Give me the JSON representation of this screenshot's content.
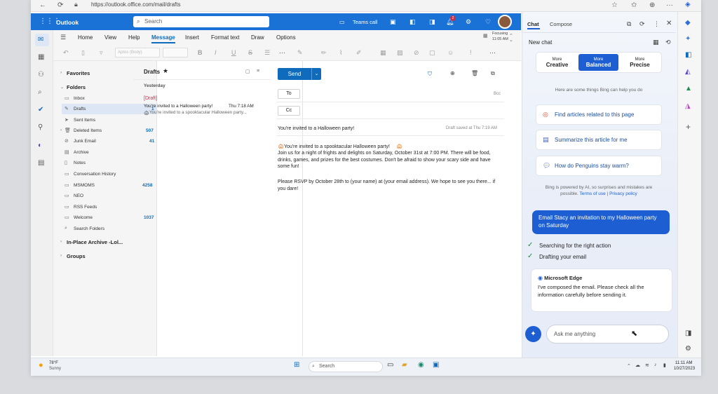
{
  "browser": {
    "url": "https://outlook.office.com/mail/drafts"
  },
  "outlook": {
    "app_name": "Outlook",
    "search_placeholder": "Search",
    "teams_call": "Teams call",
    "notif_count": "2",
    "focusing_label": "Focusing",
    "focusing_time": "11:05 AM",
    "tabs": [
      "Home",
      "View",
      "Help",
      "Message",
      "Insert",
      "Format text",
      "Draw",
      "Options"
    ],
    "active_tab": "Message",
    "font_name_placeholder": "Aptos (Body)",
    "folders": {
      "favorites_label": "Favorites",
      "folders_label": "Folders",
      "items": [
        {
          "label": "Inbox",
          "count": ""
        },
        {
          "label": "Drafts",
          "count": "1"
        },
        {
          "label": "Sent Items",
          "count": ""
        },
        {
          "label": "Deleted Items",
          "count": "507"
        },
        {
          "label": "Junk Email",
          "count": "41"
        },
        {
          "label": "Archive",
          "count": ""
        },
        {
          "label": "Notes",
          "count": ""
        },
        {
          "label": "Conversation History",
          "count": ""
        },
        {
          "label": "MSMOMS",
          "count": "4258"
        },
        {
          "label": "NEO",
          "count": ""
        },
        {
          "label": "RSS Feeds",
          "count": ""
        },
        {
          "label": "Welcome",
          "count": "1037"
        },
        {
          "label": "Search Folders",
          "count": ""
        }
      ],
      "archive_label": "In-Place Archive -Lol...",
      "groups_label": "Groups"
    },
    "message_list": {
      "title": "Drafts",
      "section": "Yesterday",
      "item": {
        "tag": "[Draft]",
        "subject": "You're invited to a Halloween party!",
        "time": "Thu 7:18 AM",
        "preview": "You're invited to a spooktacular Halloween party..."
      }
    },
    "compose": {
      "send_label": "Send",
      "to_label": "To",
      "cc_label": "Cc",
      "bcc_label": "Bcc",
      "subject": "You're invited to a Halloween party!",
      "draft_saved": "Draft saved at Thu 7:19 AM",
      "body_line1": "You're invited to a spooktacular Halloween party!",
      "body_para1": "Join us for a night of frights and delights on Saturday, October 31st at 7:00 PM. There will be food, drinks, games, and prizes for the best costumes. Don't be afraid to show your scary side and have some fun!",
      "body_para2": "Please RSVP by October 28th to (your name) at (your email address). We hope to see you there... if you dare!"
    }
  },
  "copilot": {
    "tab_chat": "Chat",
    "tab_compose": "Compose",
    "new_chat": "New chat",
    "tones": [
      {
        "top": "More",
        "name": "Creative"
      },
      {
        "top": "More",
        "name": "Balanced"
      },
      {
        "top": "More",
        "name": "Precise"
      }
    ],
    "help_text": "Here are some things Bing can help you do",
    "suggestions": [
      "Find articles related to this page",
      "Summarize this article for me",
      "How do Penguins stay warm?"
    ],
    "disclaimer_line1": "Bing is powered by AI, so surprises and mistakes are",
    "disclaimer_line2": "possible.",
    "terms_link": "Terms of use",
    "privacy_link": "Privacy policy",
    "user_message": "Email Stacy an invitation to my Halloween party on Saturday",
    "steps": [
      "Searching for the right action",
      "Drafting your email"
    ],
    "bot_name": "Microsoft Edge",
    "bot_reply": "I've composed the email. Please check all the information carefully before sending it.",
    "ask_placeholder": "Ask me anything"
  },
  "taskbar": {
    "weather_temp": "78°F",
    "weather_desc": "Sunny",
    "search_label": "Search",
    "time": "11:11 AM",
    "date": "10/27/2023"
  },
  "colors": {
    "outlook_blue": "#1a72d6",
    "accent": "#0f6cbd",
    "copilot_blue": "#1d5fd3"
  }
}
